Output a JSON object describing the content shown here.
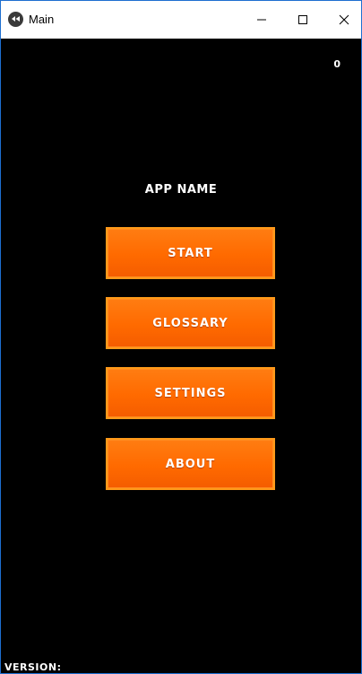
{
  "window": {
    "title": "Main",
    "controls": {
      "minimize": "minimize",
      "maximize": "maximize",
      "close": "close"
    }
  },
  "header": {
    "counter": "0"
  },
  "main": {
    "app_name": "APP NAME",
    "buttons": [
      {
        "label": "START"
      },
      {
        "label": "GLOSSARY"
      },
      {
        "label": "SETTINGS"
      },
      {
        "label": "ABOUT"
      }
    ]
  },
  "footer": {
    "version_label": "VERSION:"
  },
  "colors": {
    "background": "#000000",
    "button_fill": "#ff6a00",
    "button_border": "#ff9a1a",
    "text": "#ffffff",
    "window_border": "#1e6fd0"
  },
  "icons": {
    "app": "kivy-app-icon",
    "minimize": "minimize-icon",
    "maximize": "maximize-icon",
    "close": "close-icon"
  }
}
